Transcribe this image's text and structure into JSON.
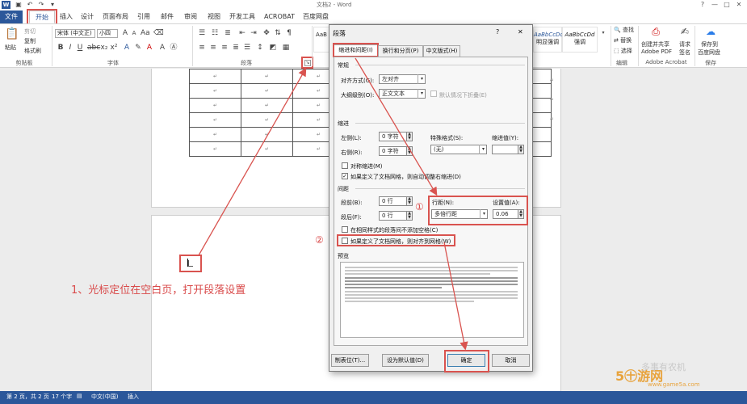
{
  "window": {
    "title": "文档2 - Word",
    "controls": [
      "?",
      "—",
      "□",
      "✕"
    ]
  },
  "ribbon_tabs": [
    {
      "label": "文件"
    },
    {
      "label": "开始"
    },
    {
      "label": "插入"
    },
    {
      "label": "设计"
    },
    {
      "label": "页面布局"
    },
    {
      "label": "引用"
    },
    {
      "label": "邮件"
    },
    {
      "label": "审阅"
    },
    {
      "label": "视图"
    },
    {
      "label": "开发工具"
    },
    {
      "label": "ACROBAT"
    },
    {
      "label": "百度网盘"
    }
  ],
  "ribbon": {
    "clipboard": {
      "paste": "粘贴",
      "cut": "剪切",
      "copy": "复制",
      "format_painter": "格式刷",
      "group": "剪贴板"
    },
    "font": {
      "name": "宋体 (中文正)",
      "size": "小四",
      "group": "字体"
    },
    "paragraph": {
      "group": "段落"
    },
    "styles": [
      {
        "sample": "AaB",
        "name": ""
      },
      {
        "sample": "AaBbCcDd",
        "name": "明显强调"
      },
      {
        "sample": "AaBbCcDd",
        "name": "强调"
      }
    ],
    "editing": {
      "find": "查找",
      "replace": "替换",
      "select": "选择",
      "group": "编辑"
    },
    "acrobat": {
      "create": "创建并共享",
      "create2": "Adobe PDF",
      "request": "请求",
      "request2": "签名",
      "group": "Adobe Acrobat"
    },
    "baidu": {
      "save": "保存到",
      "save2": "百度网盘",
      "group": "保存"
    }
  },
  "table_cell_mark": "↵",
  "dialog": {
    "title": "段落",
    "help": "?",
    "close": "✕",
    "tabs": [
      {
        "label": "缩进和间距(I)"
      },
      {
        "label": "换行和分页(P)"
      },
      {
        "label": "中文版式(H)"
      }
    ],
    "general": {
      "section": "常规",
      "alignment_label": "对齐方式(G):",
      "alignment_value": "左对齐",
      "outline_label": "大纲级别(O):",
      "outline_value": "正文文本",
      "collapsed_label": "默认情况下折叠(E)"
    },
    "indent": {
      "section": "缩进",
      "left_label": "左侧(L):",
      "left_value": "0 字符",
      "right_label": "右侧(R):",
      "right_value": "0 字符",
      "special_label": "特殊格式(S):",
      "special_value": "(无)",
      "by_label": "缩进值(Y):",
      "by_value": "",
      "mirror_label": "对称缩进(M)",
      "auto_label": "如果定义了文档网格，则自动调整右缩进(D)"
    },
    "spacing": {
      "section": "间距",
      "before_label": "段前(B):",
      "before_value": "0 行",
      "after_label": "段后(F):",
      "after_value": "0 行",
      "line_label": "行距(N):",
      "line_value": "多倍行距",
      "at_label": "设置值(A):",
      "at_value": "0.06",
      "no_space_label": "在相同样式的段落间不添加空格(C)",
      "snap_label": "如果定义了文档网格，则对齐到网格(W)"
    },
    "preview_label": "预览",
    "buttons": {
      "tabs": "制表位(T)...",
      "default": "设为默认值(D)",
      "ok": "确定",
      "cancel": "取消"
    }
  },
  "annotations": {
    "step1": "1、光标定位在空白页，打开段落设置",
    "circle1": "①",
    "circle2": "②"
  },
  "statusbar": {
    "page": "第 2 页，共 2 页",
    "words": "17 个字",
    "language": "中文(中国)",
    "mode": "插入"
  },
  "watermark": {
    "text": "5㊉游网",
    "url": "www.game5a.com",
    "faint": "多事有农机"
  }
}
